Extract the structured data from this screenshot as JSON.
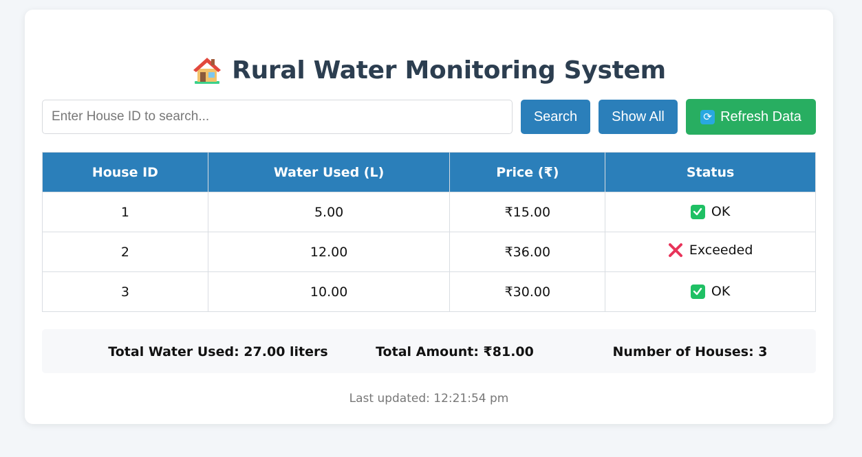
{
  "header": {
    "title": "Rural Water Monitoring System",
    "icon": "house-icon"
  },
  "search": {
    "placeholder": "Enter House ID to search...",
    "value": "",
    "search_label": "Search",
    "show_all_label": "Show All",
    "refresh_label": "Refresh Data"
  },
  "table": {
    "columns": [
      "House ID",
      "Water Used (L)",
      "Price (₹)",
      "Status"
    ],
    "rows": [
      {
        "house_id": "1",
        "water_used": "5.00",
        "price": "₹15.00",
        "status": "OK",
        "status_icon": "check-icon"
      },
      {
        "house_id": "2",
        "water_used": "12.00",
        "price": "₹36.00",
        "status": "Exceeded",
        "status_icon": "cross-icon"
      },
      {
        "house_id": "3",
        "water_used": "10.00",
        "price": "₹30.00",
        "status": "OK",
        "status_icon": "check-icon"
      }
    ]
  },
  "summary": {
    "total_water": "Total Water Used: 27.00 liters",
    "total_amount": "Total Amount: ₹81.00",
    "houses": "Number of Houses: 3"
  },
  "footer": {
    "last_updated": "Last updated: 12:21:54 pm"
  },
  "colors": {
    "primary": "#2b7fba",
    "success": "#28ae61",
    "title": "#2c3e50",
    "ok": "#1fc064",
    "exceeded": "#e8345a"
  }
}
